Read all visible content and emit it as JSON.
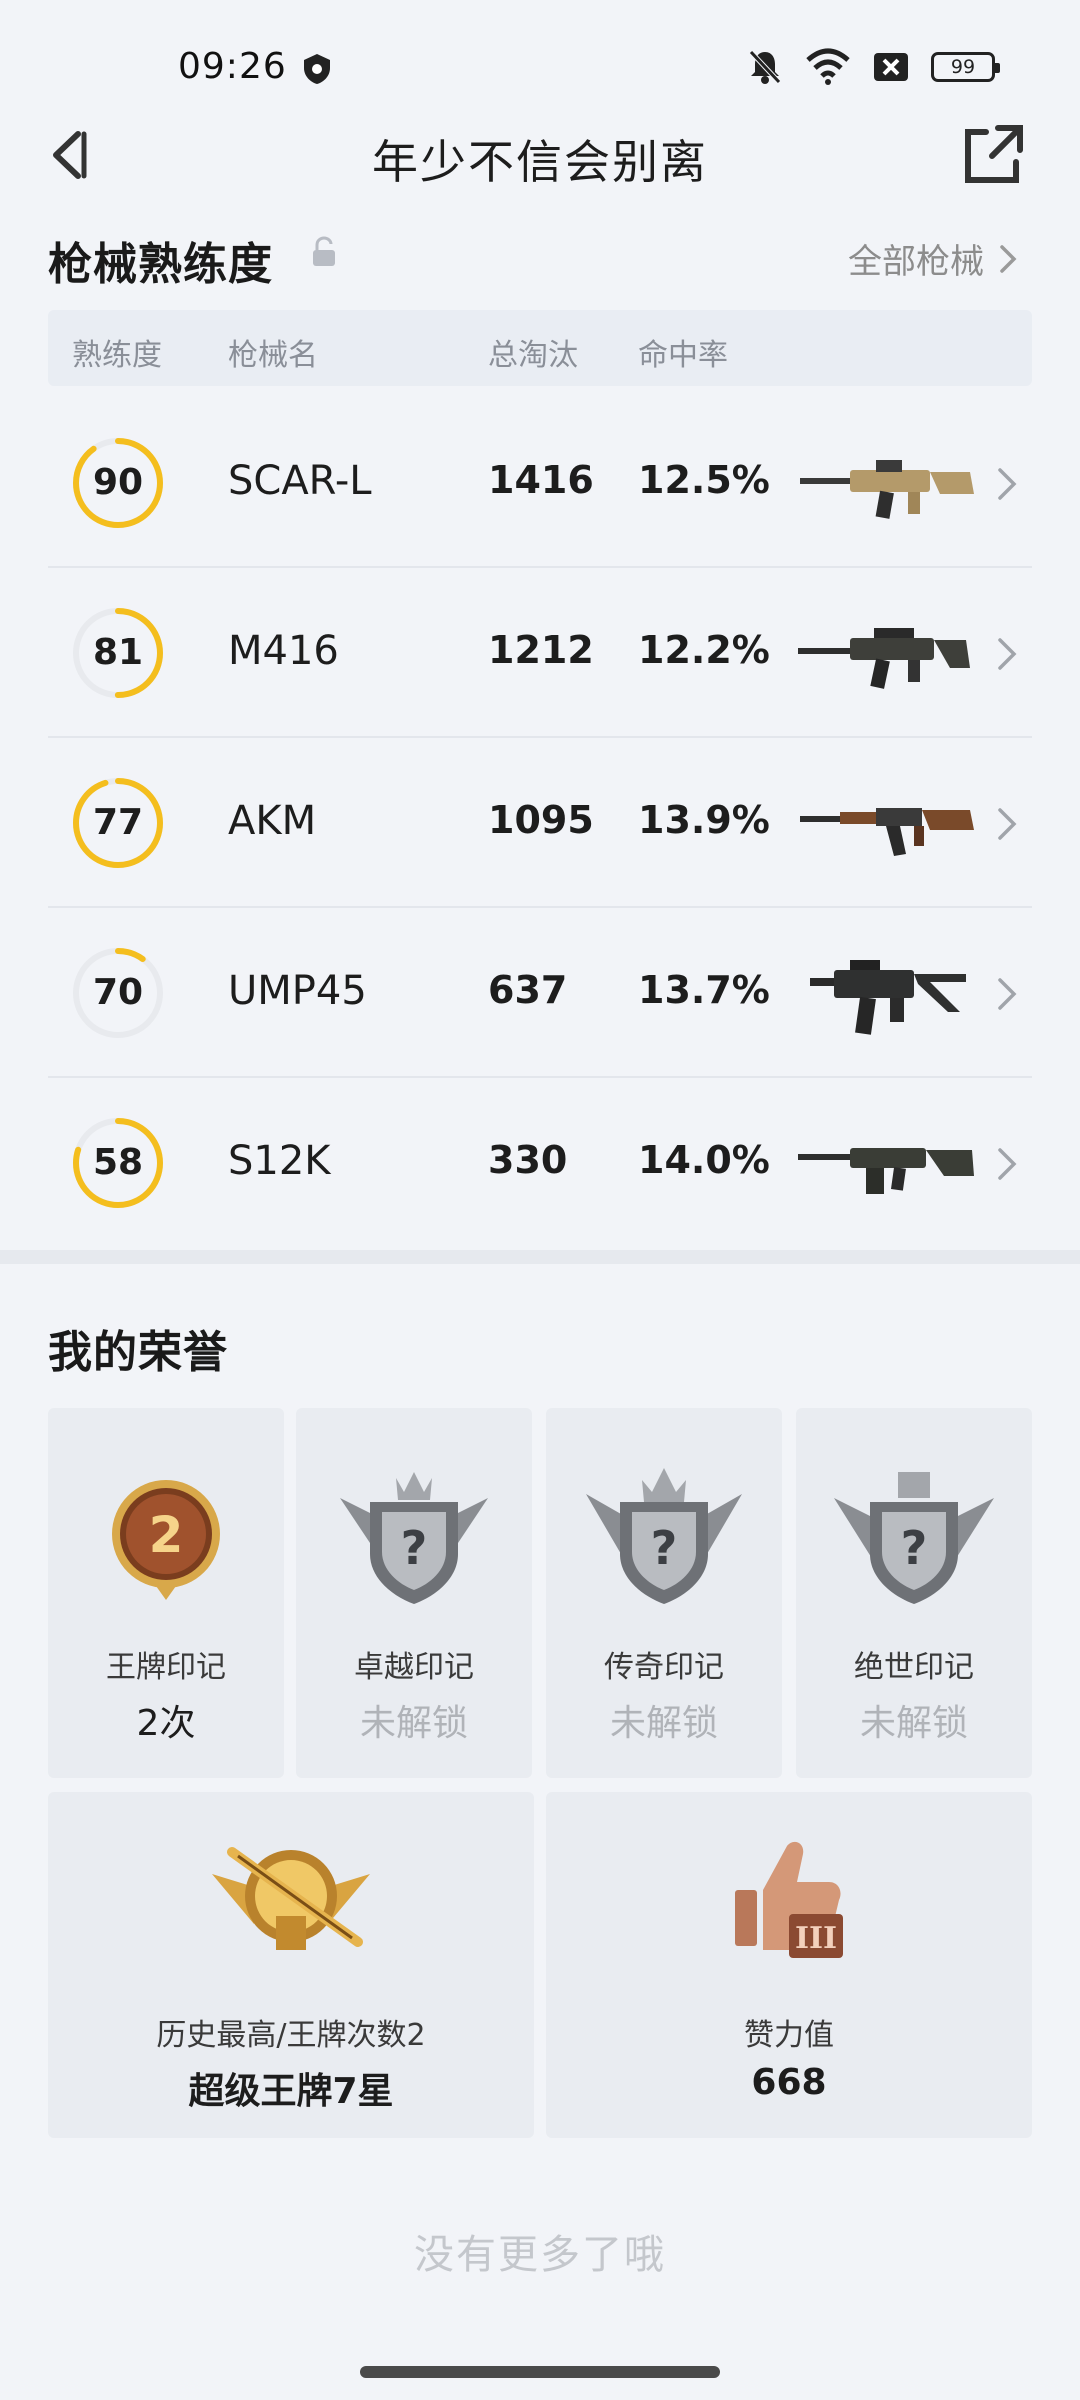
{
  "status_bar": {
    "time": "09:26",
    "battery": "99"
  },
  "header": {
    "title": "年少不信会别离"
  },
  "gun_section": {
    "title": "枪械熟练度",
    "all_link": "全部枪械",
    "columns": [
      "熟练度",
      "枪械名",
      "总淘汰",
      "命中率"
    ],
    "rows": [
      {
        "level": "90",
        "level_fraction": 0.9,
        "name": "SCAR-L",
        "kills": "1416",
        "hit_rate": "12.5%"
      },
      {
        "level": "81",
        "level_fraction": 0.5,
        "name": "M416",
        "kills": "1212",
        "hit_rate": "12.2%"
      },
      {
        "level": "77",
        "level_fraction": 0.95,
        "name": "AKM",
        "kills": "1095",
        "hit_rate": "13.9%"
      },
      {
        "level": "70",
        "level_fraction": 0.1,
        "name": "UMP45",
        "kills": "637",
        "hit_rate": "13.7%"
      },
      {
        "level": "58",
        "level_fraction": 0.8,
        "name": "S12K",
        "kills": "330",
        "hit_rate": "14.0%"
      }
    ]
  },
  "honor_section": {
    "title": "我的荣誉",
    "badges": [
      {
        "label": "王牌印记",
        "value": "2次",
        "badge_number": "2",
        "locked": false
      },
      {
        "label": "卓越印记",
        "value": "未解锁",
        "locked": true
      },
      {
        "label": "传奇印记",
        "value": "未解锁",
        "locked": true
      },
      {
        "label": "绝世印记",
        "value": "未解锁",
        "locked": true
      }
    ],
    "large": [
      {
        "label": "历史最高/王牌次数2",
        "value": "超级王牌7星"
      },
      {
        "label": "赞力值",
        "value": "668"
      }
    ]
  },
  "footer": {
    "no_more": "没有更多了哦"
  },
  "colors": {
    "ring": "#f4be1e",
    "ring_track": "#e8eaee",
    "accent_gold": "#c9962c",
    "muted": "#8c8c8c"
  }
}
